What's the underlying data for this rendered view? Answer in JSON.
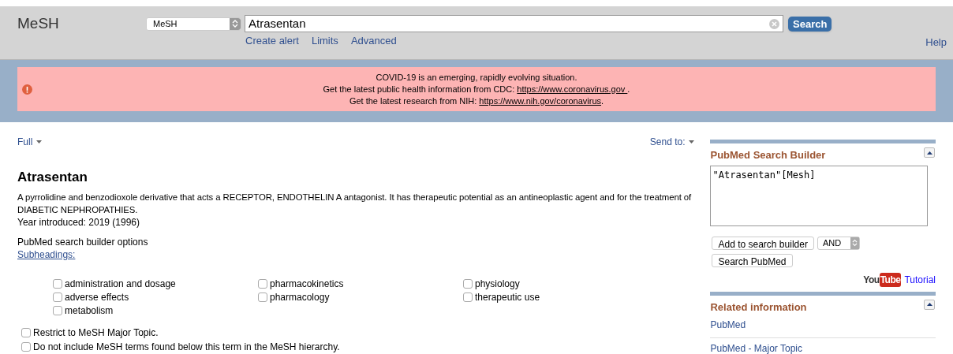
{
  "header": {
    "title": "MeSH",
    "database": "MeSH",
    "query": "Atrasentan",
    "search_button": "Search",
    "links": [
      "Create alert",
      "Limits",
      "Advanced"
    ],
    "help": "Help"
  },
  "banner": {
    "lines": [
      {
        "before": "COVID-19 is an emerging, rapidly evolving situation."
      },
      {
        "before": "Get the latest public health information from CDC: ",
        "link": "https://www.coronavirus.gov ",
        "after": "."
      },
      {
        "before": "Get the latest research from NIH: ",
        "link": "https://www.nih.gov/coronavirus",
        "after": "."
      }
    ]
  },
  "toolbar": {
    "format": "Full",
    "send_to": "Send to:"
  },
  "record": {
    "title": "Atrasentan",
    "description": "A pyrrolidine and benzodioxole derivative that acts a RECEPTOR, ENDOTHELIN A antagonist. It has therapeutic potential as an antineoplastic agent and for the treatment of DIABETIC NEPHROPATHIES.",
    "year": "Year introduced: 2019 (1996)"
  },
  "builder_options": {
    "title": "PubMed search builder options",
    "subheadings_link": "Subheadings:",
    "subheading_columns": [
      [
        {
          "label": "administration and dosage",
          "checked": false
        },
        {
          "label": "adverse effects",
          "checked": false
        },
        {
          "label": "metabolism",
          "checked": false
        }
      ],
      [
        {
          "label": "pharmacokinetics",
          "checked": false
        },
        {
          "label": "pharmacology",
          "checked": false
        }
      ],
      [
        {
          "label": "physiology",
          "checked": false
        },
        {
          "label": "therapeutic use",
          "checked": false
        }
      ]
    ],
    "options": [
      {
        "label": "Restrict to MeSH Major Topic.",
        "checked": false
      },
      {
        "label": "Do not include MeSH terms found below this term in the MeSH hierarchy.",
        "checked": false
      }
    ]
  },
  "search_builder": {
    "title": "PubMed Search Builder",
    "query": "\"Atrasentan\"[Mesh]",
    "add_button": "Add to search builder",
    "operator": "AND",
    "search_button": "Search PubMed",
    "logo_you": "You",
    "logo_tube": "Tube",
    "tutorial": "Tutorial"
  },
  "related": {
    "title": "Related information",
    "links": [
      "PubMed",
      "PubMed - Major Topic"
    ]
  }
}
